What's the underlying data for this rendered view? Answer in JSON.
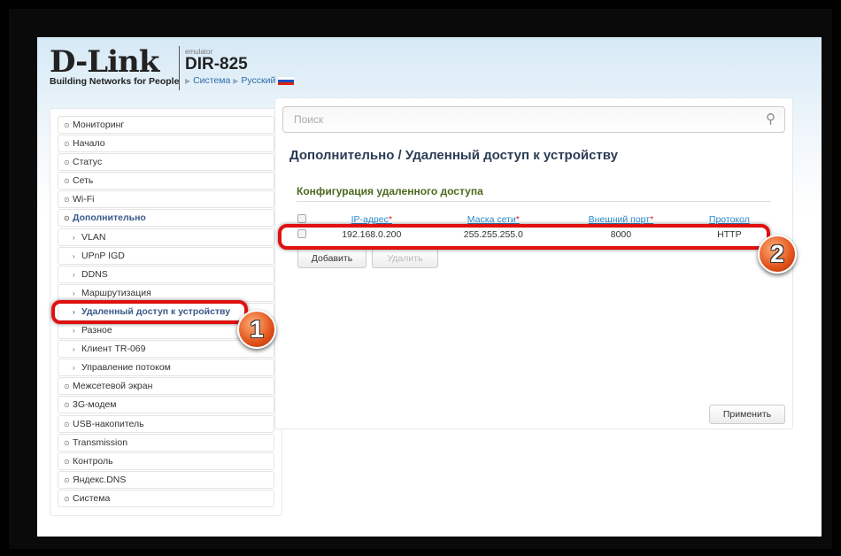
{
  "header": {
    "brand": "D-Link",
    "tagline": "Building Networks for People",
    "emulator": "emulator",
    "model": "DIR-825",
    "crumbs": [
      "Система",
      "Русский"
    ]
  },
  "sidebar": {
    "items": [
      {
        "label": "Мониторинг",
        "type": "group"
      },
      {
        "label": "Начало",
        "type": "group"
      },
      {
        "label": "Статус",
        "type": "group"
      },
      {
        "label": "Сеть",
        "type": "group"
      },
      {
        "label": "Wi-Fi",
        "type": "group"
      },
      {
        "label": "Дополнительно",
        "type": "open"
      },
      {
        "label": "VLAN",
        "type": "sub"
      },
      {
        "label": "UPnP IGD",
        "type": "sub"
      },
      {
        "label": "DDNS",
        "type": "sub"
      },
      {
        "label": "Маршрутизация",
        "type": "sub"
      },
      {
        "label": "Удаленный доступ к устройству",
        "type": "sub-active"
      },
      {
        "label": "Разное",
        "type": "sub"
      },
      {
        "label": "Клиент TR-069",
        "type": "sub"
      },
      {
        "label": "Управление потоком",
        "type": "sub"
      },
      {
        "label": "Межсетевой экран",
        "type": "group"
      },
      {
        "label": "3G-модем",
        "type": "group"
      },
      {
        "label": "USB-накопитель",
        "type": "group"
      },
      {
        "label": "Transmission",
        "type": "group"
      },
      {
        "label": "Контроль",
        "type": "group"
      },
      {
        "label": "Яндекс.DNS",
        "type": "group"
      },
      {
        "label": "Система",
        "type": "group"
      }
    ]
  },
  "main": {
    "search_placeholder": "Поиск",
    "title": "Дополнительно /  Удаленный доступ к устройству",
    "section": "Конфигурация удаленного доступа",
    "columns": [
      "IP-адрес",
      "Маска сети",
      "Внешний порт",
      "Протокол"
    ],
    "rows": [
      {
        "ip": "192.168.0.200",
        "mask": "255.255.255.0",
        "port": "8000",
        "protocol": "HTTP"
      }
    ],
    "add_label": "Добавить",
    "delete_label": "Удалить",
    "apply_label": "Применить"
  },
  "annotations": {
    "badge1": "1",
    "badge2": "2",
    "highlight_color": "#e01010"
  }
}
